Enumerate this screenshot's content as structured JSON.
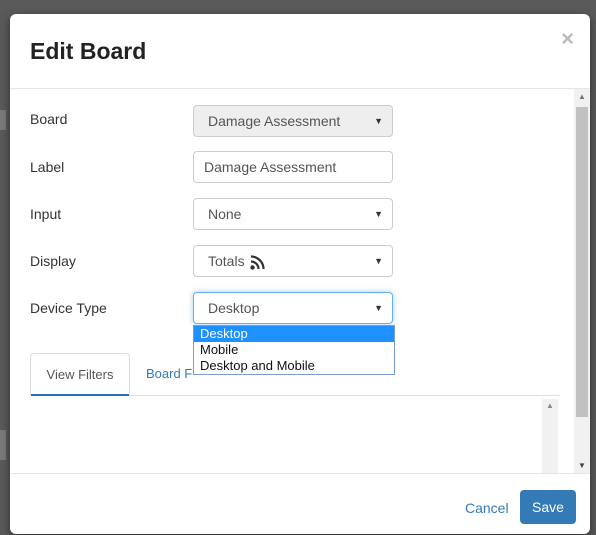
{
  "modal": {
    "title": "Edit Board",
    "close_glyph": "×"
  },
  "fields": [
    {
      "label": "Board",
      "value": "Damage Assessment"
    },
    {
      "label": "Label",
      "value": "Damage Assessment"
    },
    {
      "label": "Input",
      "value": "None"
    },
    {
      "label": "Display",
      "value": "Totals"
    },
    {
      "label": "Device Type",
      "value": "Desktop"
    }
  ],
  "device_type_options": [
    "Desktop",
    "Mobile",
    "Desktop and Mobile"
  ],
  "tabs": [
    "View Filters",
    "Board F"
  ],
  "footer": {
    "cancel": "Cancel",
    "save": "Save"
  },
  "glyphs": {
    "caret": "▼",
    "up": "▲",
    "down": "▼"
  },
  "colors": {
    "primary": "#337ab7",
    "selected_option": "#1e90ff"
  }
}
